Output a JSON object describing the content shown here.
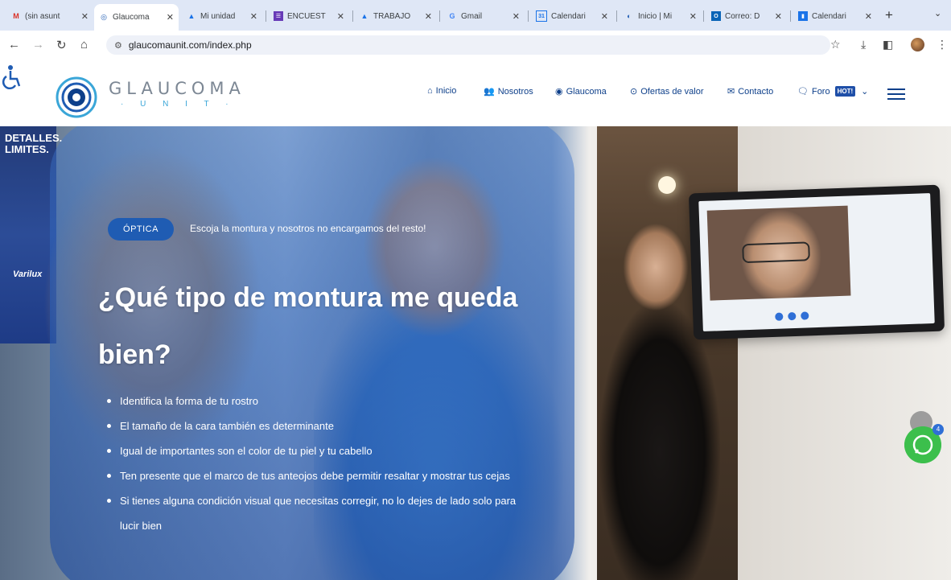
{
  "browser": {
    "tabs": [
      {
        "title": "(sin asunt",
        "icon": "gmail-icon",
        "active": false
      },
      {
        "title": "Glaucoma",
        "icon": "glaucoma-icon",
        "active": true
      },
      {
        "title": "Mi unidad",
        "icon": "drive-icon",
        "active": false
      },
      {
        "title": "ENCUEST",
        "icon": "forms-icon",
        "active": false
      },
      {
        "title": "TRABAJO",
        "icon": "drive-icon",
        "active": false
      },
      {
        "title": "Gmail",
        "icon": "google-icon",
        "active": false
      },
      {
        "title": "Calendari",
        "icon": "calendar-icon",
        "active": false
      },
      {
        "title": "Inicio | Mi",
        "icon": "site-icon",
        "active": false
      },
      {
        "title": "Correo: D",
        "icon": "outlook-icon",
        "active": false
      },
      {
        "title": "Calendari",
        "icon": "calendar-icon",
        "active": false
      }
    ],
    "url": "glaucomaunit.com/index.php"
  },
  "site": {
    "logo_text": "GLAUCOMA",
    "logo_sub": "· U N I T ·",
    "nav": [
      {
        "label": "Inicio",
        "icon": "home-icon"
      },
      {
        "label": "Nosotros",
        "icon": "people-icon"
      },
      {
        "label": "Glaucoma",
        "icon": "eye-icon"
      },
      {
        "label": "Ofertas de valor",
        "icon": "check-circle-icon"
      },
      {
        "label": "Contacto",
        "icon": "mail-icon"
      },
      {
        "label": "Foro",
        "icon": "chat-icon"
      }
    ],
    "hot_badge": "HOT!"
  },
  "hero": {
    "badge": "ÓPTICA",
    "tagline": "Escoja la montura y nosotros no encargamos del resto!",
    "headline": "¿Qué tipo de montura me queda bien?",
    "bullets": [
      "Identifica la forma de tu rostro",
      "El tamaño de la cara también es determinante",
      "Igual de importantes son el color de tu piel y tu cabello",
      "Ten presente que el marco de tus anteojos debe permitir resaltar y mostrar tus cejas",
      "Si tienes alguna condición visual que necesitas corregir, no lo dejes de lado solo para lucir bien"
    ],
    "poster_text": "DETALLES. LIMITES.",
    "poster_brand": "Varilux"
  },
  "whatsapp_count": "4",
  "colors": {
    "brand_blue": "#0d3f8a",
    "accent_blue": "#1f5cb3",
    "hot_badge": "#1f4fa8",
    "whatsapp": "#3cbf4c"
  }
}
